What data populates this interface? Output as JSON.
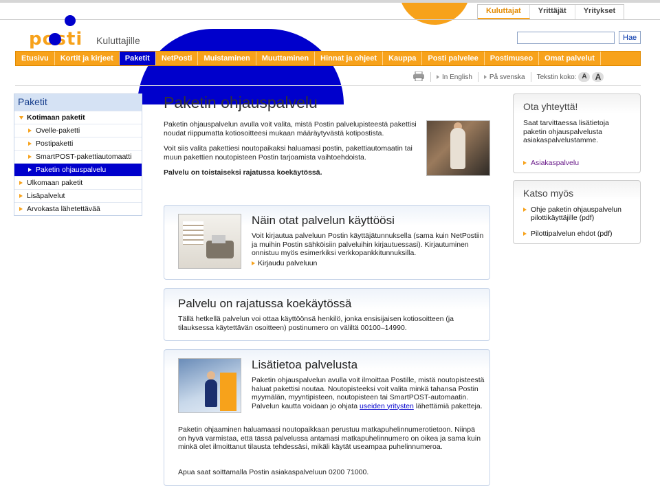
{
  "header": {
    "audience_tabs": [
      "Kuluttajat",
      "Yrittäjät",
      "Yritykset"
    ],
    "logo_text": "posti",
    "section_label": "Kuluttajille",
    "search_button": "Hae",
    "search_value": ""
  },
  "nav": [
    "Etusivu",
    "Kortit ja kirjeet",
    "Paketit",
    "NetPosti",
    "Muistaminen",
    "Muuttaminen",
    "Hinnat ja ohjeet",
    "Kauppa",
    "Posti palvelee",
    "Postimuseo",
    "Omat palvelut"
  ],
  "utility": {
    "english": "In English",
    "swedish": "På svenska",
    "text_size_label": "Tekstin koko:",
    "size_small": "A",
    "size_large": "A"
  },
  "sidebar": {
    "title": "Paketit",
    "items": [
      {
        "label": "Kotimaan paketit"
      },
      {
        "label": "Ovelle-paketti"
      },
      {
        "label": "Postipaketti"
      },
      {
        "label": "SmartPOST-pakettiautomaatti"
      },
      {
        "label": "Paketin ohjauspalvelu"
      },
      {
        "label": "Ulkomaan paketit"
      },
      {
        "label": "Lisäpalvelut"
      },
      {
        "label": "Arvokasta lähetettävää"
      }
    ]
  },
  "main": {
    "title": "Paketin ohjauspalvelu",
    "intro_p1": "Paketin ohjauspalvelun avulla voit valita, mistä Postin palvelupisteestä pakettisi noudat riippumatta kotiosoitteesi mukaan määräytyvästä kotipostista.",
    "intro_p2": "Voit siis valita pakettiesi noutopaikaksi haluamasi postin, pakettiautomaatin tai muun pakettien noutopisteen Postin tarjoamista vaihtoehdoista.",
    "intro_p3": "Palvelu on toistaiseksi rajatussa koekäytössä.",
    "box1": {
      "title": "Näin otat palvelun käyttöösi",
      "text": "Voit kirjautua palveluun Postin käyttäjätunnuksella (sama kuin NetPostiin ja muihin Postin sähköisiin palveluihin kirjautuessasi). Kirjautuminen onnistuu myös esimerkiksi verkkopankkitunnuksilla.",
      "link": "Kirjaudu palveluun"
    },
    "box2": {
      "title": "Palvelu on rajatussa koekäytössä",
      "text": "Tällä hetkellä palvelun voi ottaa käyttöönsä henkilö, jonka ensisijaisen kotiosoitteen (ja tilauksessa käytettävän osoitteen) postinumero on väliltä 00100–14990."
    },
    "box3": {
      "title": "Lisätietoa palvelusta",
      "text1_a": "Paketin ohjauspalvelun avulla voit ilmoittaa Postille, mistä noutopisteestä haluat pakettisi noutaa. Noutopisteeksi voit valita minkä tahansa Postin myymälän, myyntipisteen, noutopisteen tai SmartPOST-automaatin. Palvelun kautta voidaan jo ohjata ",
      "text1_link": "useiden yritysten",
      "text1_b": " lähettämiä paketteja.",
      "text2": "Paketin ohjaaminen haluamaasi noutopaikkaan perustuu matkapuhelinnumerotietoon. Niinpä on hyvä varmistaa, että tässä palvelussa antamasi matkapuhelinnumero on oikea ja sama kuin minkä olet ilmoittanut tilausta tehdessäsi, mikäli käytät useampaa puhelinnumeroa.",
      "text3": "Apua saat soittamalla Postin asiakaspalveluun 0200 71000."
    }
  },
  "right": {
    "contact": {
      "title": "Ota yhteyttä!",
      "text": "Saat tarvittaessa lisätietoja paketin ohjauspalvelusta asiakaspalvelustamme.",
      "link": "Asiakaspalvelu"
    },
    "see_also": {
      "title": "Katso myös",
      "links": [
        "Ohje paketin ohjauspalvelun pilottikäyttäjille (pdf)",
        "Pilottipalvelun ehdot (pdf)"
      ]
    }
  },
  "colors": {
    "orange": "#f7a21b",
    "blue": "#0000cc"
  }
}
